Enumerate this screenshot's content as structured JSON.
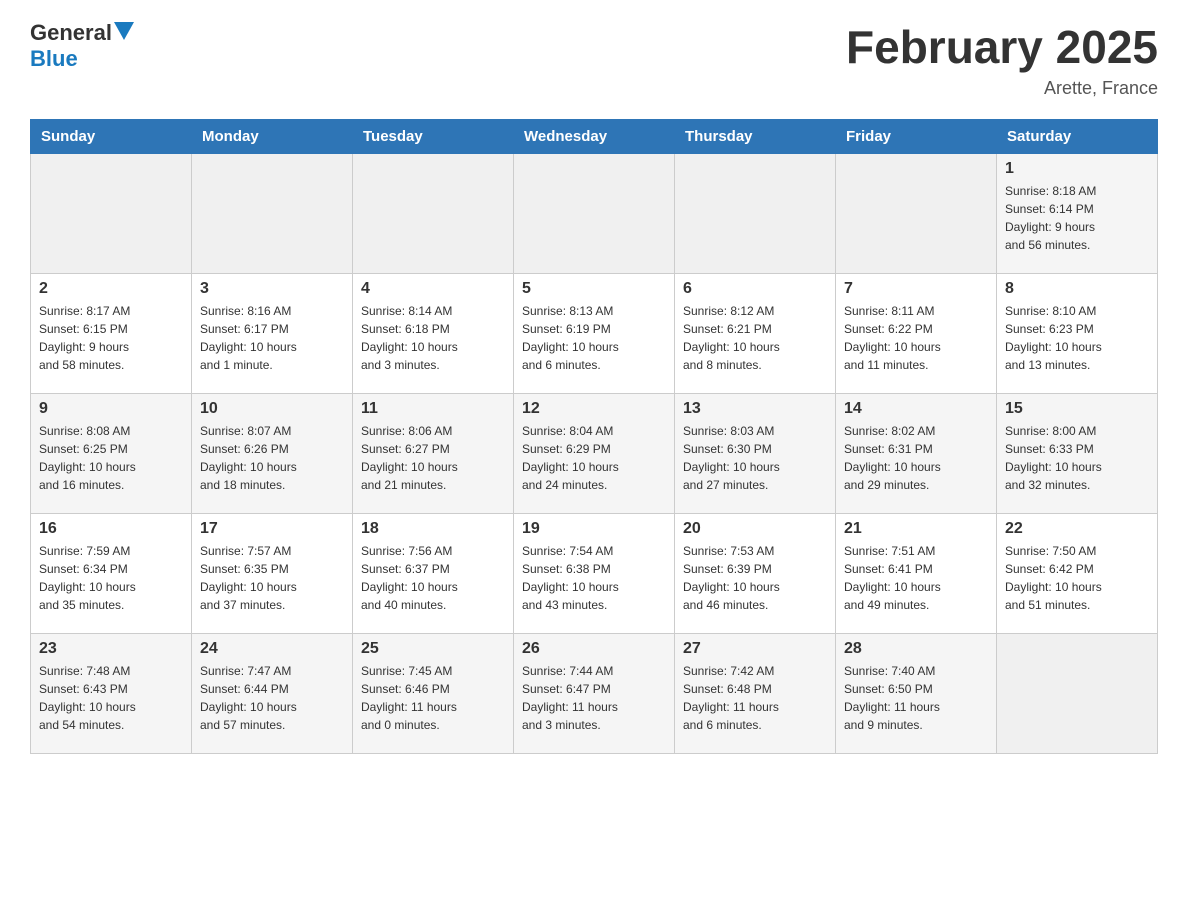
{
  "header": {
    "title": "February 2025",
    "location": "Arette, France"
  },
  "logo": {
    "general": "General",
    "blue": "Blue"
  },
  "weekdays": [
    "Sunday",
    "Monday",
    "Tuesday",
    "Wednesday",
    "Thursday",
    "Friday",
    "Saturday"
  ],
  "weeks": [
    {
      "days": [
        {
          "num": "",
          "info": ""
        },
        {
          "num": "",
          "info": ""
        },
        {
          "num": "",
          "info": ""
        },
        {
          "num": "",
          "info": ""
        },
        {
          "num": "",
          "info": ""
        },
        {
          "num": "",
          "info": ""
        },
        {
          "num": "1",
          "info": "Sunrise: 8:18 AM\nSunset: 6:14 PM\nDaylight: 9 hours\nand 56 minutes."
        }
      ]
    },
    {
      "days": [
        {
          "num": "2",
          "info": "Sunrise: 8:17 AM\nSunset: 6:15 PM\nDaylight: 9 hours\nand 58 minutes."
        },
        {
          "num": "3",
          "info": "Sunrise: 8:16 AM\nSunset: 6:17 PM\nDaylight: 10 hours\nand 1 minute."
        },
        {
          "num": "4",
          "info": "Sunrise: 8:14 AM\nSunset: 6:18 PM\nDaylight: 10 hours\nand 3 minutes."
        },
        {
          "num": "5",
          "info": "Sunrise: 8:13 AM\nSunset: 6:19 PM\nDaylight: 10 hours\nand 6 minutes."
        },
        {
          "num": "6",
          "info": "Sunrise: 8:12 AM\nSunset: 6:21 PM\nDaylight: 10 hours\nand 8 minutes."
        },
        {
          "num": "7",
          "info": "Sunrise: 8:11 AM\nSunset: 6:22 PM\nDaylight: 10 hours\nand 11 minutes."
        },
        {
          "num": "8",
          "info": "Sunrise: 8:10 AM\nSunset: 6:23 PM\nDaylight: 10 hours\nand 13 minutes."
        }
      ]
    },
    {
      "days": [
        {
          "num": "9",
          "info": "Sunrise: 8:08 AM\nSunset: 6:25 PM\nDaylight: 10 hours\nand 16 minutes."
        },
        {
          "num": "10",
          "info": "Sunrise: 8:07 AM\nSunset: 6:26 PM\nDaylight: 10 hours\nand 18 minutes."
        },
        {
          "num": "11",
          "info": "Sunrise: 8:06 AM\nSunset: 6:27 PM\nDaylight: 10 hours\nand 21 minutes."
        },
        {
          "num": "12",
          "info": "Sunrise: 8:04 AM\nSunset: 6:29 PM\nDaylight: 10 hours\nand 24 minutes."
        },
        {
          "num": "13",
          "info": "Sunrise: 8:03 AM\nSunset: 6:30 PM\nDaylight: 10 hours\nand 27 minutes."
        },
        {
          "num": "14",
          "info": "Sunrise: 8:02 AM\nSunset: 6:31 PM\nDaylight: 10 hours\nand 29 minutes."
        },
        {
          "num": "15",
          "info": "Sunrise: 8:00 AM\nSunset: 6:33 PM\nDaylight: 10 hours\nand 32 minutes."
        }
      ]
    },
    {
      "days": [
        {
          "num": "16",
          "info": "Sunrise: 7:59 AM\nSunset: 6:34 PM\nDaylight: 10 hours\nand 35 minutes."
        },
        {
          "num": "17",
          "info": "Sunrise: 7:57 AM\nSunset: 6:35 PM\nDaylight: 10 hours\nand 37 minutes."
        },
        {
          "num": "18",
          "info": "Sunrise: 7:56 AM\nSunset: 6:37 PM\nDaylight: 10 hours\nand 40 minutes."
        },
        {
          "num": "19",
          "info": "Sunrise: 7:54 AM\nSunset: 6:38 PM\nDaylight: 10 hours\nand 43 minutes."
        },
        {
          "num": "20",
          "info": "Sunrise: 7:53 AM\nSunset: 6:39 PM\nDaylight: 10 hours\nand 46 minutes."
        },
        {
          "num": "21",
          "info": "Sunrise: 7:51 AM\nSunset: 6:41 PM\nDaylight: 10 hours\nand 49 minutes."
        },
        {
          "num": "22",
          "info": "Sunrise: 7:50 AM\nSunset: 6:42 PM\nDaylight: 10 hours\nand 51 minutes."
        }
      ]
    },
    {
      "days": [
        {
          "num": "23",
          "info": "Sunrise: 7:48 AM\nSunset: 6:43 PM\nDaylight: 10 hours\nand 54 minutes."
        },
        {
          "num": "24",
          "info": "Sunrise: 7:47 AM\nSunset: 6:44 PM\nDaylight: 10 hours\nand 57 minutes."
        },
        {
          "num": "25",
          "info": "Sunrise: 7:45 AM\nSunset: 6:46 PM\nDaylight: 11 hours\nand 0 minutes."
        },
        {
          "num": "26",
          "info": "Sunrise: 7:44 AM\nSunset: 6:47 PM\nDaylight: 11 hours\nand 3 minutes."
        },
        {
          "num": "27",
          "info": "Sunrise: 7:42 AM\nSunset: 6:48 PM\nDaylight: 11 hours\nand 6 minutes."
        },
        {
          "num": "28",
          "info": "Sunrise: 7:40 AM\nSunset: 6:50 PM\nDaylight: 11 hours\nand 9 minutes."
        },
        {
          "num": "",
          "info": ""
        }
      ]
    }
  ]
}
